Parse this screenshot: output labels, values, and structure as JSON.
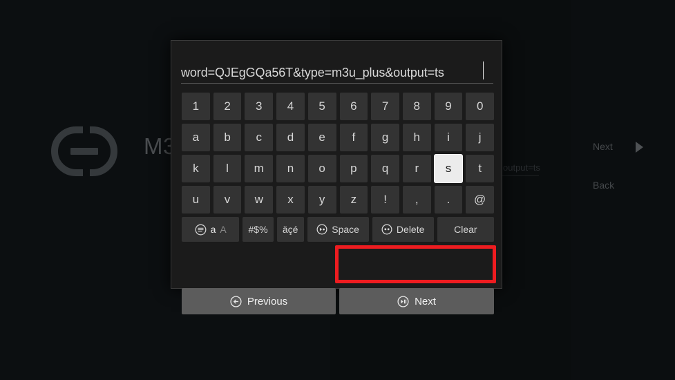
{
  "background": {
    "link_icon": "link-icon",
    "app_title_partial": "M3",
    "field_text_partial": "output=ts",
    "next_label": "Next",
    "next_arrow_icon": "play-triangle-icon",
    "back_label": "Back"
  },
  "keyboard": {
    "input": {
      "value": "word=QJEgGQa56T&type=m3u_plus&output=ts",
      "caret": true
    },
    "rows": [
      {
        "name": "digits",
        "keys": [
          "1",
          "2",
          "3",
          "4",
          "5",
          "6",
          "7",
          "8",
          "9",
          "0"
        ]
      },
      {
        "name": "letters1",
        "keys": [
          "a",
          "b",
          "c",
          "d",
          "e",
          "f",
          "g",
          "h",
          "i",
          "j"
        ]
      },
      {
        "name": "letters2",
        "keys": [
          "k",
          "l",
          "m",
          "n",
          "o",
          "p",
          "q",
          "r",
          "s",
          "t"
        ]
      },
      {
        "name": "letters3",
        "keys": [
          "u",
          "v",
          "w",
          "x",
          "y",
          "z",
          "!",
          ",",
          ".",
          "@"
        ]
      }
    ],
    "selected_key": "s",
    "function_row": [
      {
        "name": "case-toggle",
        "icon": "circle-menu-icon",
        "lower": "a",
        "upper": "A"
      },
      {
        "name": "symbols",
        "icon": "",
        "label": "#$%"
      },
      {
        "name": "accents",
        "icon": "",
        "label": "äçé"
      },
      {
        "name": "space",
        "icon": "circle-fastforward-icon",
        "label": "Space"
      },
      {
        "name": "delete",
        "icon": "circle-twodots-icon",
        "label": "Delete"
      },
      {
        "name": "clear",
        "icon": "",
        "label": "Clear"
      }
    ],
    "nav_row": [
      {
        "name": "previous",
        "icon": "circle-rewind-icon",
        "label": "Previous",
        "highlighted": false
      },
      {
        "name": "next",
        "icon": "circle-playpause-icon",
        "label": "Next",
        "highlighted": true
      }
    ]
  },
  "annotation": {
    "target": "Next",
    "color": "#ee1c20"
  },
  "colors": {
    "dialog_bg": "#1b1b1b",
    "key_bg": "#333333",
    "key_selected_bg": "#ececec",
    "nav_key_bg": "#5c5c5c",
    "screen_bg": "#0c0f11",
    "annotation": "#ee1c20"
  }
}
